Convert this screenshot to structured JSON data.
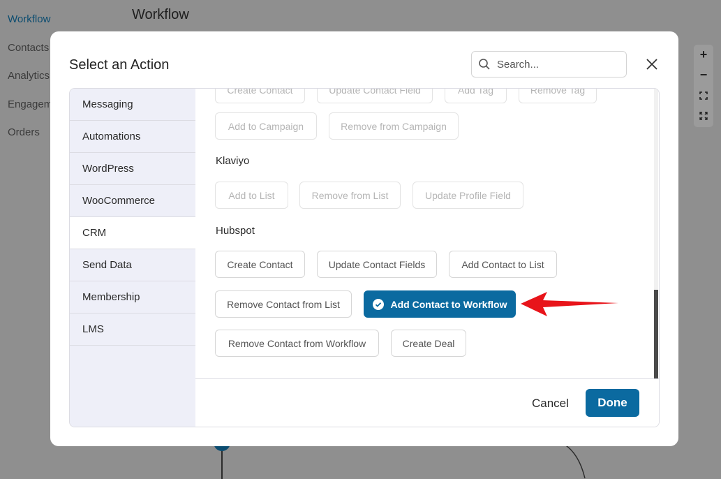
{
  "background": {
    "nav": [
      "Workflow",
      "Contacts",
      "Analytics",
      "Engagem",
      "Orders"
    ],
    "page_title": "Workflow",
    "zoom": {
      "zoom_in": "+",
      "zoom_out": "−"
    }
  },
  "modal": {
    "title": "Select an Action",
    "search_placeholder": "Search...",
    "sidebar": [
      "Messaging",
      "Automations",
      "WordPress",
      "WooCommerce",
      "CRM",
      "Send Data",
      "Membership",
      "LMS"
    ],
    "active_sidebar": "CRM",
    "partial_row": [
      "Create Contact",
      "Update Contact Field",
      "Add Tag",
      "Remove Tag"
    ],
    "row2": [
      "Add to Campaign",
      "Remove from Campaign"
    ],
    "klaviyo": {
      "label": "Klaviyo",
      "actions": [
        "Add to List",
        "Remove from List",
        "Update Profile Field"
      ]
    },
    "hubspot": {
      "label": "Hubspot",
      "row1": [
        "Create Contact",
        "Update Contact Fields",
        "Add Contact to List"
      ],
      "remove_from_list": "Remove Contact from List",
      "selected": "Add Contact to Workflow",
      "remove_from_workflow": "Remove Contact from Workflow",
      "create_deal": "Create Deal"
    },
    "footer": {
      "cancel": "Cancel",
      "done": "Done"
    }
  },
  "colors": {
    "primary": "#0b6aa0",
    "annotation_arrow": "#e8141a",
    "overlay": "#8f8f8f"
  }
}
